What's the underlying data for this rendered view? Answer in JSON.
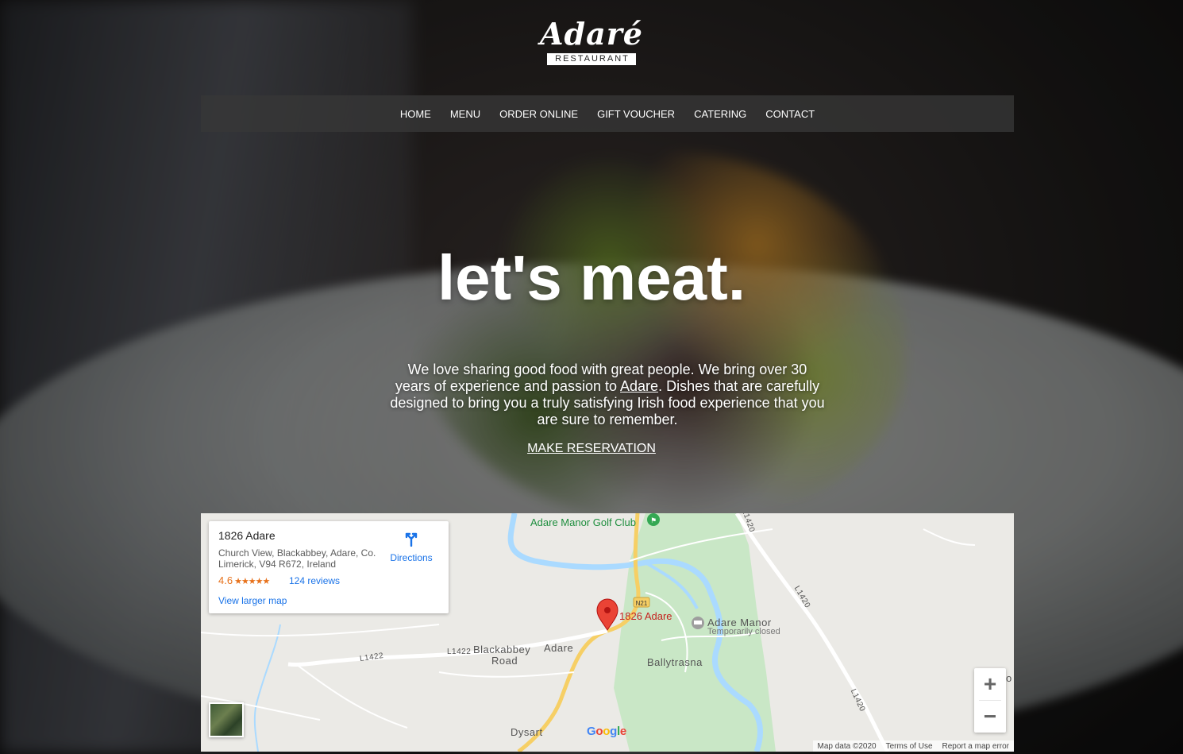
{
  "brand": {
    "name": "Adaré",
    "subtitle": "RESTAURANT"
  },
  "nav": {
    "items": [
      "HOME",
      "MENU",
      "ORDER ONLINE",
      "GIFT VOUCHER",
      "CATERING",
      "CONTACT"
    ]
  },
  "hero": {
    "headline": "let's meat.",
    "intro_before": "We love sharing good food with great people. We bring over 30 years of experience and passion to ",
    "intro_link": "Adare",
    "intro_after": ". Dishes that are carefully designed to bring you a truly satisfying Irish food experience that you are sure to remember.",
    "cta": "MAKE RESERVATION"
  },
  "map": {
    "card": {
      "title": "1826 Adare",
      "address": "Church View, Blackabbey, Adare, Co. Limerick, V94 R672, Ireland",
      "rating": "4.6",
      "stars": "★★★★★",
      "reviews": "124 reviews",
      "larger_map": "View larger map",
      "directions": "Directions"
    },
    "labels": {
      "golf_club": "Adare Manor Golf Club",
      "pin": "1826 Adare",
      "manor": "Adare Manor",
      "manor_status": "Temporarily closed",
      "blackabbey": "Blackabbey",
      "road": "Road",
      "adare": "Adare",
      "ballytrasna": "Ballytrasna",
      "dysart": "Dysart",
      "l1422_a": "L1422",
      "l1422_b": "L1422",
      "l1420_a": "L1420",
      "l1420_b": "L1420",
      "l1420_top": "L1420",
      "n21": "N21",
      "edge_o": "o"
    },
    "zoom_in": "+",
    "zoom_out": "−",
    "google": [
      "G",
      "o",
      "o",
      "g",
      "l",
      "e"
    ],
    "google_colors": [
      "#4285f4",
      "#ea4335",
      "#fbbc05",
      "#4285f4",
      "#34a853",
      "#ea4335"
    ],
    "footer": [
      "Map data ©2020",
      "Terms of Use",
      "Report a map error"
    ]
  }
}
